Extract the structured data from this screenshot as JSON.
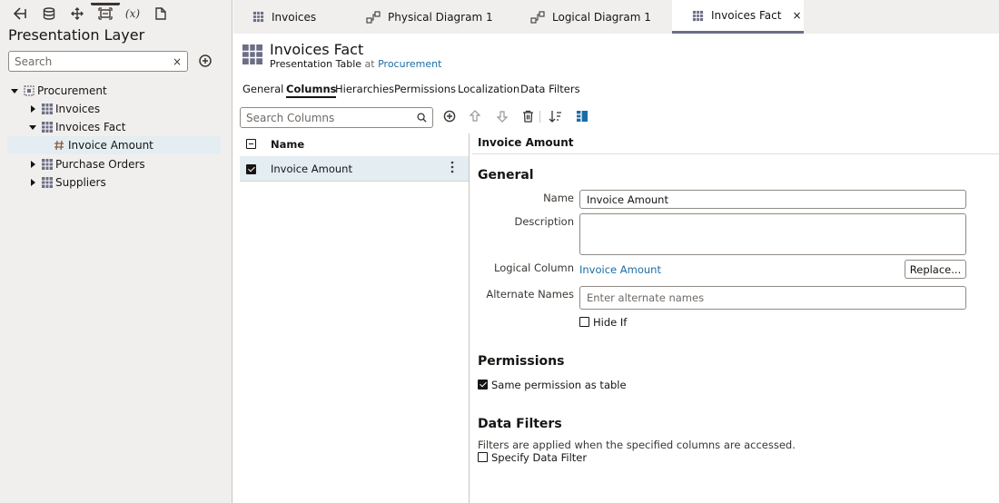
{
  "left_panel": {
    "toolbar": [
      "back-icon",
      "database-icon",
      "move-icon",
      "presentation-layer-icon",
      "variable-fx-icon",
      "document-icon"
    ],
    "fx_label": "(x)",
    "title": "Presentation Layer",
    "search": {
      "placeholder": "Search",
      "value": "",
      "clear": "×"
    },
    "tree": [
      {
        "label": "Procurement",
        "level": 0,
        "expanded": true
      },
      {
        "label": "Invoices",
        "level": 1,
        "expanded": false
      },
      {
        "label": "Invoices Fact",
        "level": 1,
        "expanded": true
      },
      {
        "label": "Invoice Amount",
        "level": 2,
        "selected": true
      },
      {
        "label": "Purchase Orders",
        "level": 1,
        "expanded": false
      },
      {
        "label": "Suppliers",
        "level": 1,
        "expanded": false
      }
    ]
  },
  "tabs": [
    {
      "label": "Invoices",
      "active": false
    },
    {
      "label": "Physical Diagram 1",
      "active": false
    },
    {
      "label": "Logical Diagram 1",
      "active": false
    },
    {
      "label": "Invoices Fact",
      "active": true,
      "close": "×"
    }
  ],
  "header": {
    "title": "Invoices Fact",
    "subtitle_prefix": "Presentation Table",
    "subtitle_at": "at",
    "subtitle_link": "Procurement"
  },
  "subtabs": [
    "General",
    "Columns",
    "Hierarchies",
    "Permissions",
    "Localization",
    "Data Filters"
  ],
  "active_subtab": "Columns",
  "columns": {
    "search_placeholder": "Search Columns",
    "header": "Name",
    "rows": [
      {
        "name": "Invoice Amount",
        "checked": true
      }
    ]
  },
  "detail": {
    "heading": "Invoice Amount",
    "general": {
      "title": "General",
      "name_label": "Name",
      "name_value": "Invoice Amount",
      "description_label": "Description",
      "description_value": "",
      "logical_column_label": "Logical Column",
      "logical_column_value": "Invoice Amount",
      "replace_label": "Replace...",
      "alternate_names_label": "Alternate Names",
      "alternate_names_placeholder": "Enter alternate names",
      "hide_if_label": "Hide If",
      "hide_if_checked": false
    },
    "permissions": {
      "title": "Permissions",
      "same_permission_label": "Same permission as table",
      "same_permission_checked": true
    },
    "data_filters": {
      "title": "Data Filters",
      "note": "Filters are applied when the specified columns are accessed.",
      "specify_label": "Specify Data Filter",
      "specify_checked": false
    }
  },
  "colors": {
    "accent": "#1a6da6",
    "panel_bg": "#f1efed",
    "selected_row": "#e4edf2",
    "tab_indicator": "#6b6e85"
  }
}
